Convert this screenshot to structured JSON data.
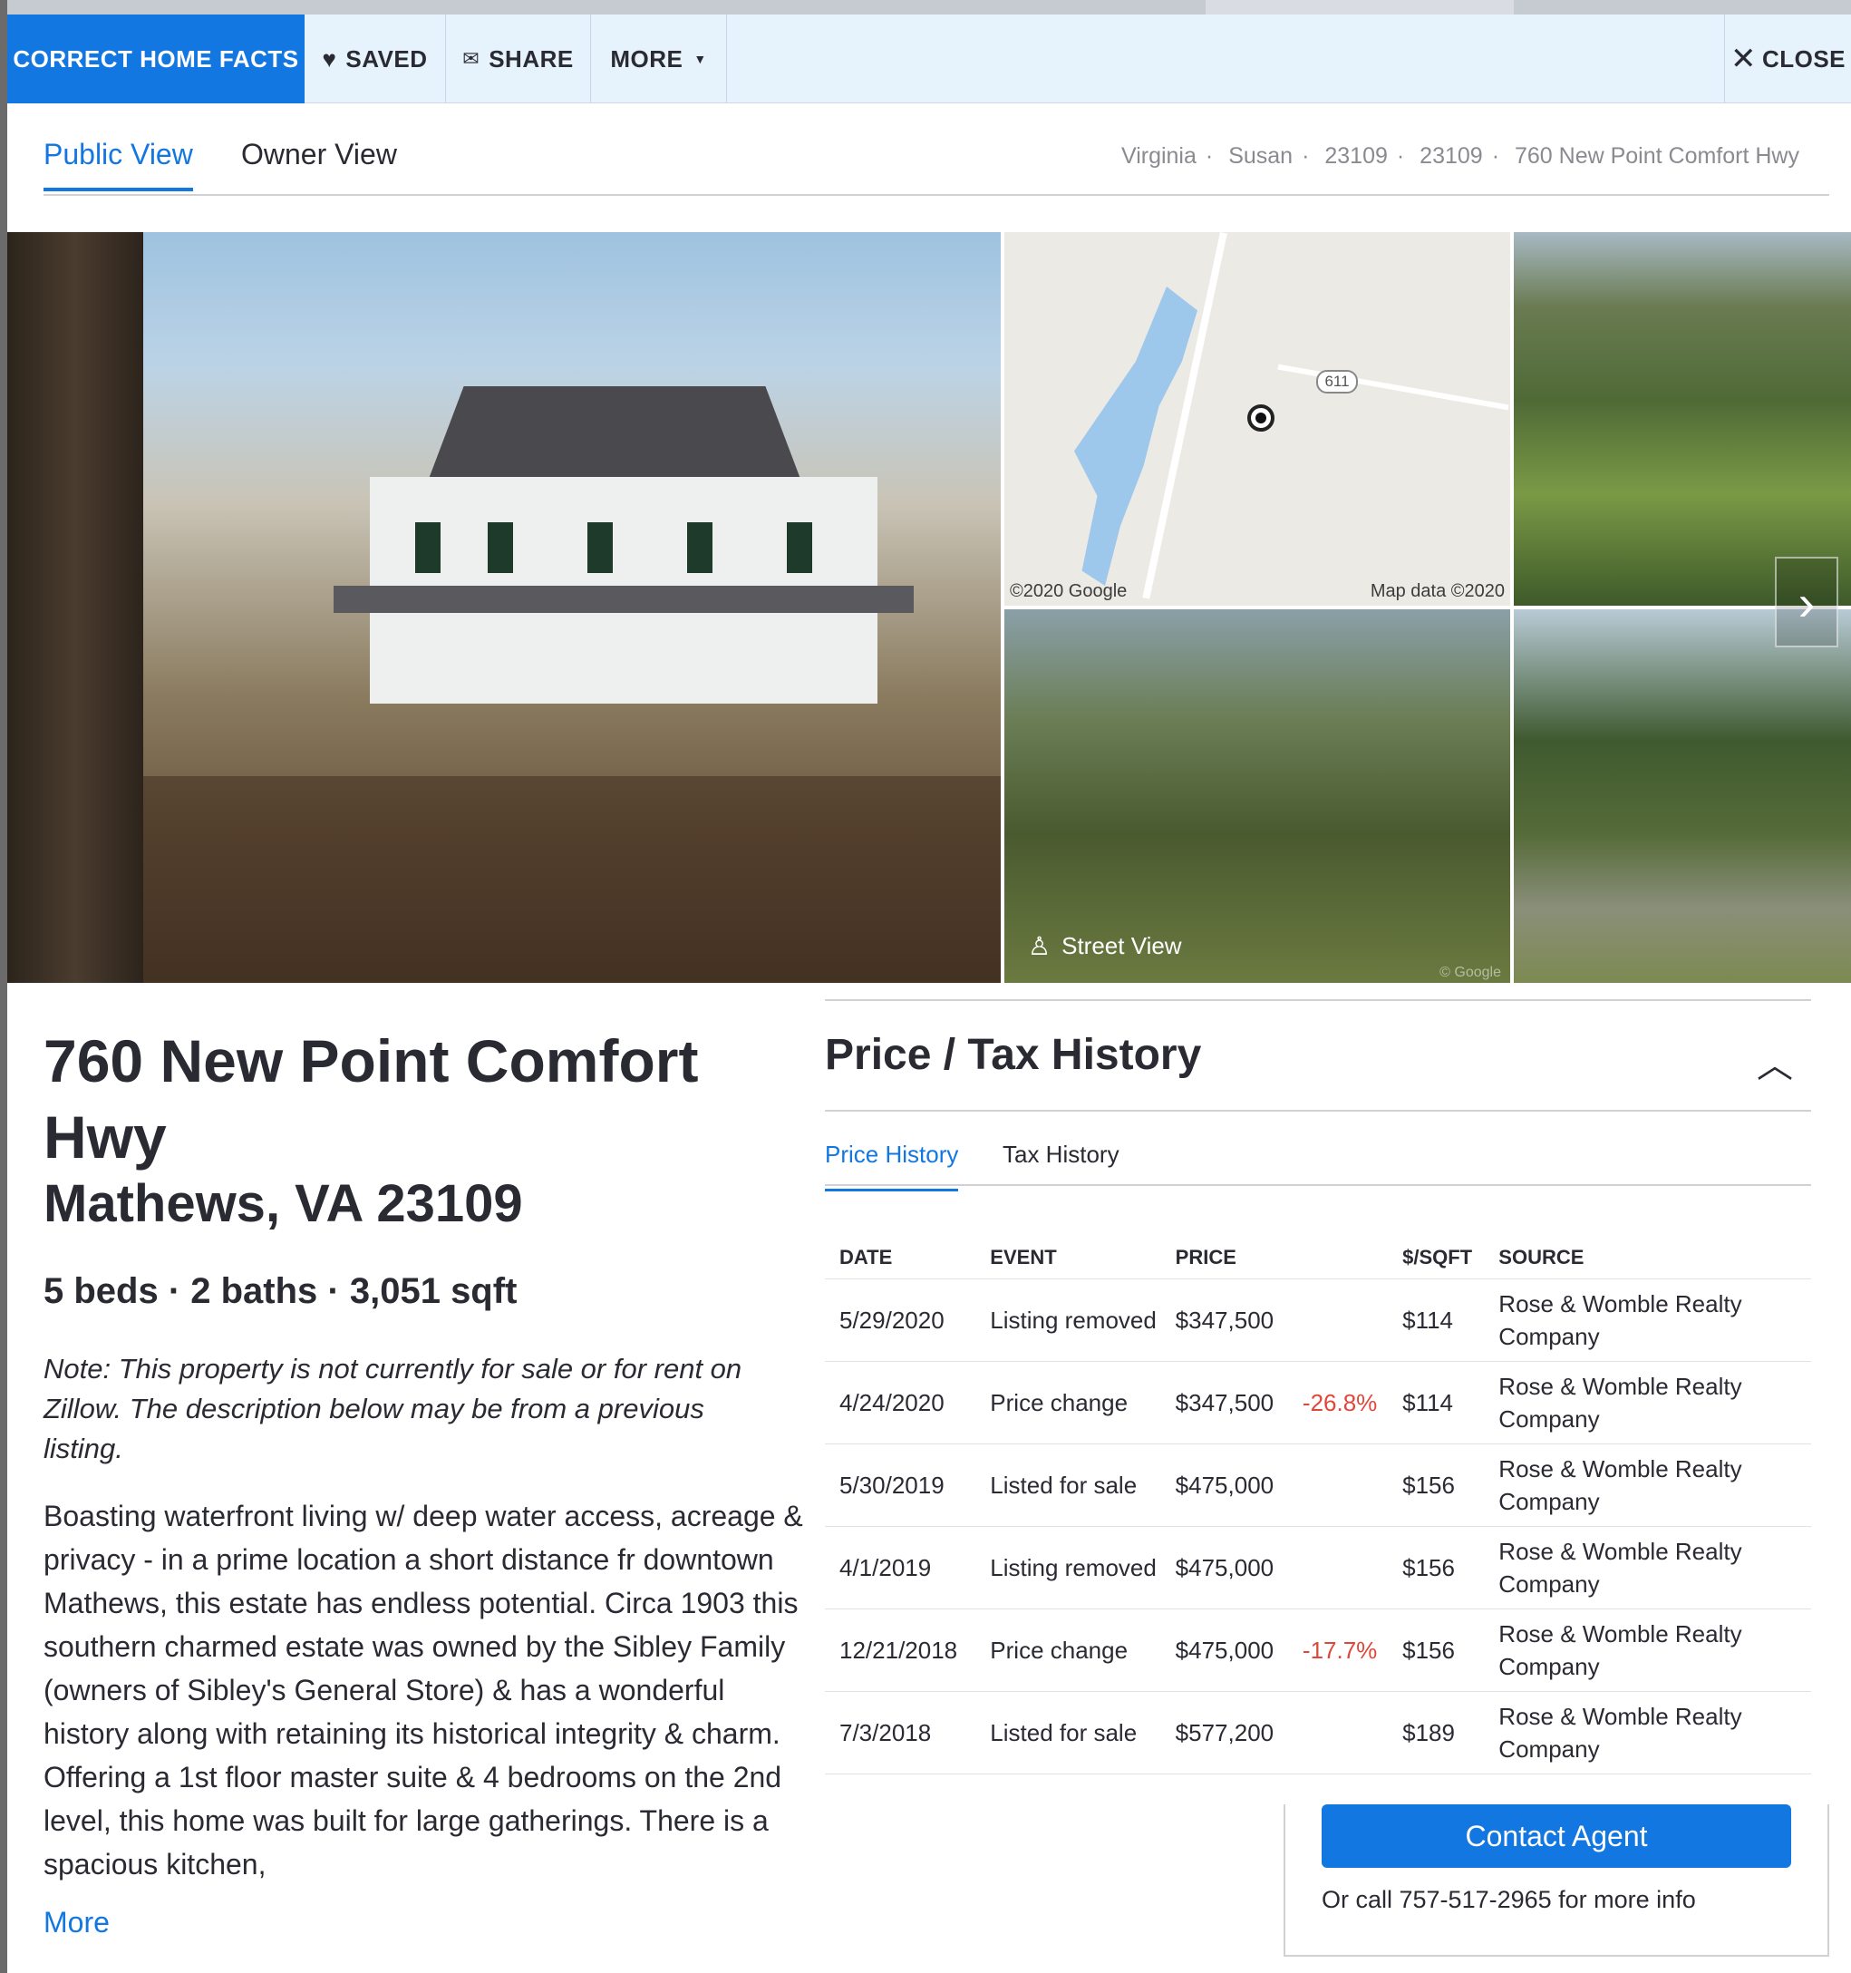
{
  "header": {
    "correct_facts_label": "CORRECT HOME FACTS",
    "saved_label": "SAVED",
    "share_label": "SHARE",
    "more_label": "MORE",
    "close_label": "CLOSE"
  },
  "view_tabs": {
    "public_label": "Public View",
    "owner_label": "Owner View",
    "active": "Public View"
  },
  "breadcrumb": [
    "Virginia",
    "Susan",
    "23109",
    "23109",
    "760 New Point Comfort Hwy"
  ],
  "gallery": {
    "map_credit_left": "©2020 Google",
    "map_credit_right": "Map data ©2020",
    "route_number": "611",
    "street_view_label": "Street View",
    "google_mark": "© Google"
  },
  "property": {
    "address_line1": "760 New Point Comfort Hwy",
    "address_line2": "Mathews, VA 23109",
    "facts": "5 beds · 2 baths · 3,051 sqft",
    "note": "Note: This property is not currently for sale or for rent on Zillow. The description below may be from a previous listing.",
    "description": "Boasting waterfront living w/ deep water access, acreage & privacy - in a prime location a short distance fr downtown Mathews, this estate has endless potential. Circa 1903 this southern charmed estate was owned by the Sibley Family (owners of Sibley's General Store) & has a wonderful history along with retaining its historical integrity & charm. Offering a 1st floor master suite & 4 bedrooms on the 2nd level, this home was built for large gatherings. There is a spacious kitchen,",
    "more_label": "More"
  },
  "price_history": {
    "title": "Price / Tax History",
    "tabs": [
      "Price History",
      "Tax History"
    ],
    "active_tab": "Price History",
    "columns": [
      "DATE",
      "EVENT",
      "PRICE",
      "",
      "$/SQFT",
      "SOURCE"
    ],
    "rows": [
      {
        "date": "5/29/2020",
        "event": "Listing removed",
        "price": "$347,500",
        "change": "",
        "sqft": "$114",
        "source": "Rose & Womble Realty Company"
      },
      {
        "date": "4/24/2020",
        "event": "Price change",
        "price": "$347,500",
        "change": "-26.8%",
        "sqft": "$114",
        "source": "Rose & Womble Realty Company"
      },
      {
        "date": "5/30/2019",
        "event": "Listed for sale",
        "price": "$475,000",
        "change": "",
        "sqft": "$156",
        "source": "Rose & Womble Realty Company"
      },
      {
        "date": "4/1/2019",
        "event": "Listing removed",
        "price": "$475,000",
        "change": "",
        "sqft": "$156",
        "source": "Rose & Womble Realty Company"
      },
      {
        "date": "12/21/2018",
        "event": "Price change",
        "price": "$475,000",
        "change": "-17.7%",
        "sqft": "$156",
        "source": "Rose & Womble Realty Company"
      },
      {
        "date": "7/3/2018",
        "event": "Listed for sale",
        "price": "$577,200",
        "change": "",
        "sqft": "$189",
        "source": "Rose & Womble Realty Company"
      }
    ]
  },
  "contact": {
    "button_label": "Contact Agent",
    "call_text": "Or call 757-517-2965 for more info"
  },
  "colors": {
    "accent": "#1277e1",
    "header_bg": "#e6f2fc",
    "negative": "#e0473a",
    "text": "#2a2a33"
  },
  "icons": {
    "saved": "heart-icon",
    "share": "envelope-icon",
    "more": "caret-down-icon",
    "close": "close-icon",
    "street_view": "pegman-icon",
    "collapse": "chevron-up-icon",
    "next": "chevron-right-icon"
  }
}
